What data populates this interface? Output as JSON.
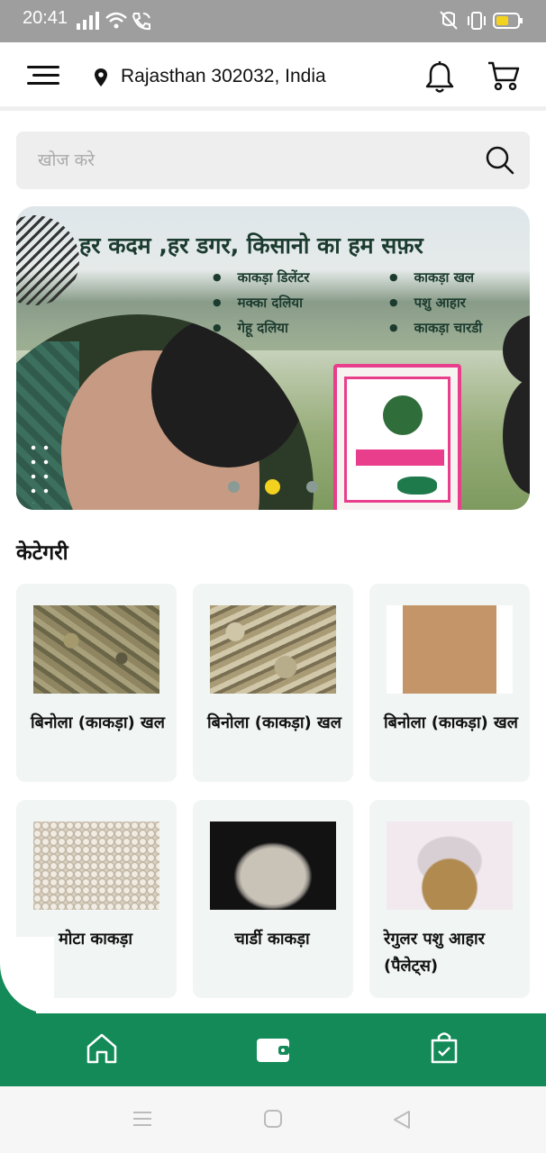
{
  "status_bar": {
    "time": "20:41",
    "icons": [
      "signal-icon",
      "wifi-icon",
      "wifi-call-icon",
      "vibrate-off-icon",
      "vibrate-icon",
      "battery-icon"
    ],
    "battery_color": "#f2d21f"
  },
  "header": {
    "location": "Rajasthan 302032, India",
    "icons": [
      "menu-icon",
      "location-pin-icon",
      "bell-icon",
      "cart-icon"
    ]
  },
  "search": {
    "placeholder": "खोज करे"
  },
  "banner": {
    "headline": "हर कदम ,हर डगर, किसानो  का हम सफ़र",
    "left_items": [
      "काकड़ा डिलेंटर",
      "मक्का दलिया",
      "गेहू दलिया"
    ],
    "right_items": [
      "काकड़ा खल",
      "पशु आहार",
      "काकड़ा चारडी"
    ],
    "slide_count": 3,
    "active_slide": 2
  },
  "categories": {
    "title": "केटेगरी",
    "items": [
      {
        "label": "बिनोला (काकड़ा) खल"
      },
      {
        "label": "बिनोला (काकड़ा) खल"
      },
      {
        "label": "बिनोला (काकड़ा) खल"
      },
      {
        "label": "मोटा काकड़ा"
      },
      {
        "label": "चार्डी काकड़ा"
      },
      {
        "label": "रेगुलर पशु आहार (पैलेट्स)"
      }
    ]
  },
  "bottom_nav": {
    "items": [
      "home-icon",
      "wallet-icon",
      "orders-bag-icon"
    ],
    "color": "#138a58"
  },
  "system_nav": {
    "items": [
      "recents-icon",
      "home-circle-icon",
      "back-icon"
    ]
  }
}
